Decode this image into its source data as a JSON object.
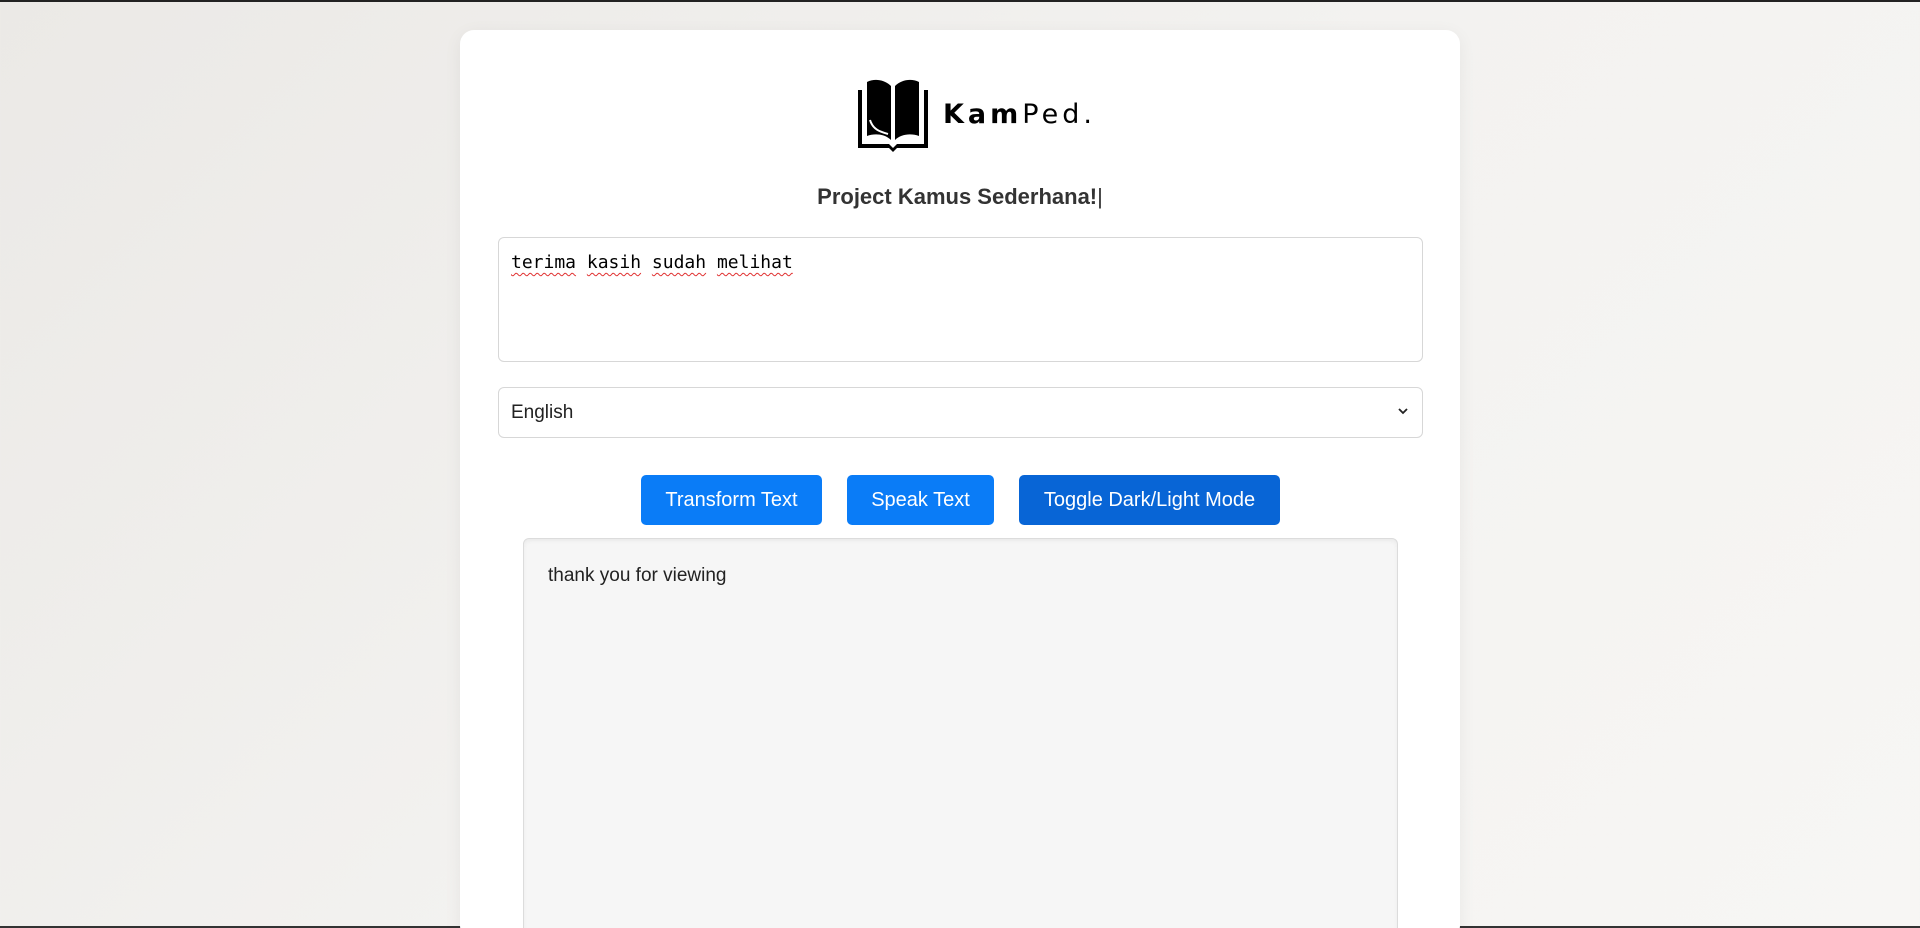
{
  "logo": {
    "icon": "open-book-icon",
    "text_bold": "Kam",
    "text_light": "Ped."
  },
  "page_title": "Project Kamus Sederhana!",
  "input": {
    "words": [
      "terima",
      "kasih",
      "sudah",
      "melihat"
    ]
  },
  "language_select": {
    "selected": "English",
    "icon": "chevron-down-icon"
  },
  "buttons": {
    "transform": "Transform Text",
    "speak": "Speak Text",
    "toggle": "Toggle Dark/Light Mode"
  },
  "output": {
    "text": "thank you for viewing"
  },
  "colors": {
    "primary_button": "#0a7cf7",
    "toggle_button": "#0865d6",
    "title_text": "#333333"
  }
}
